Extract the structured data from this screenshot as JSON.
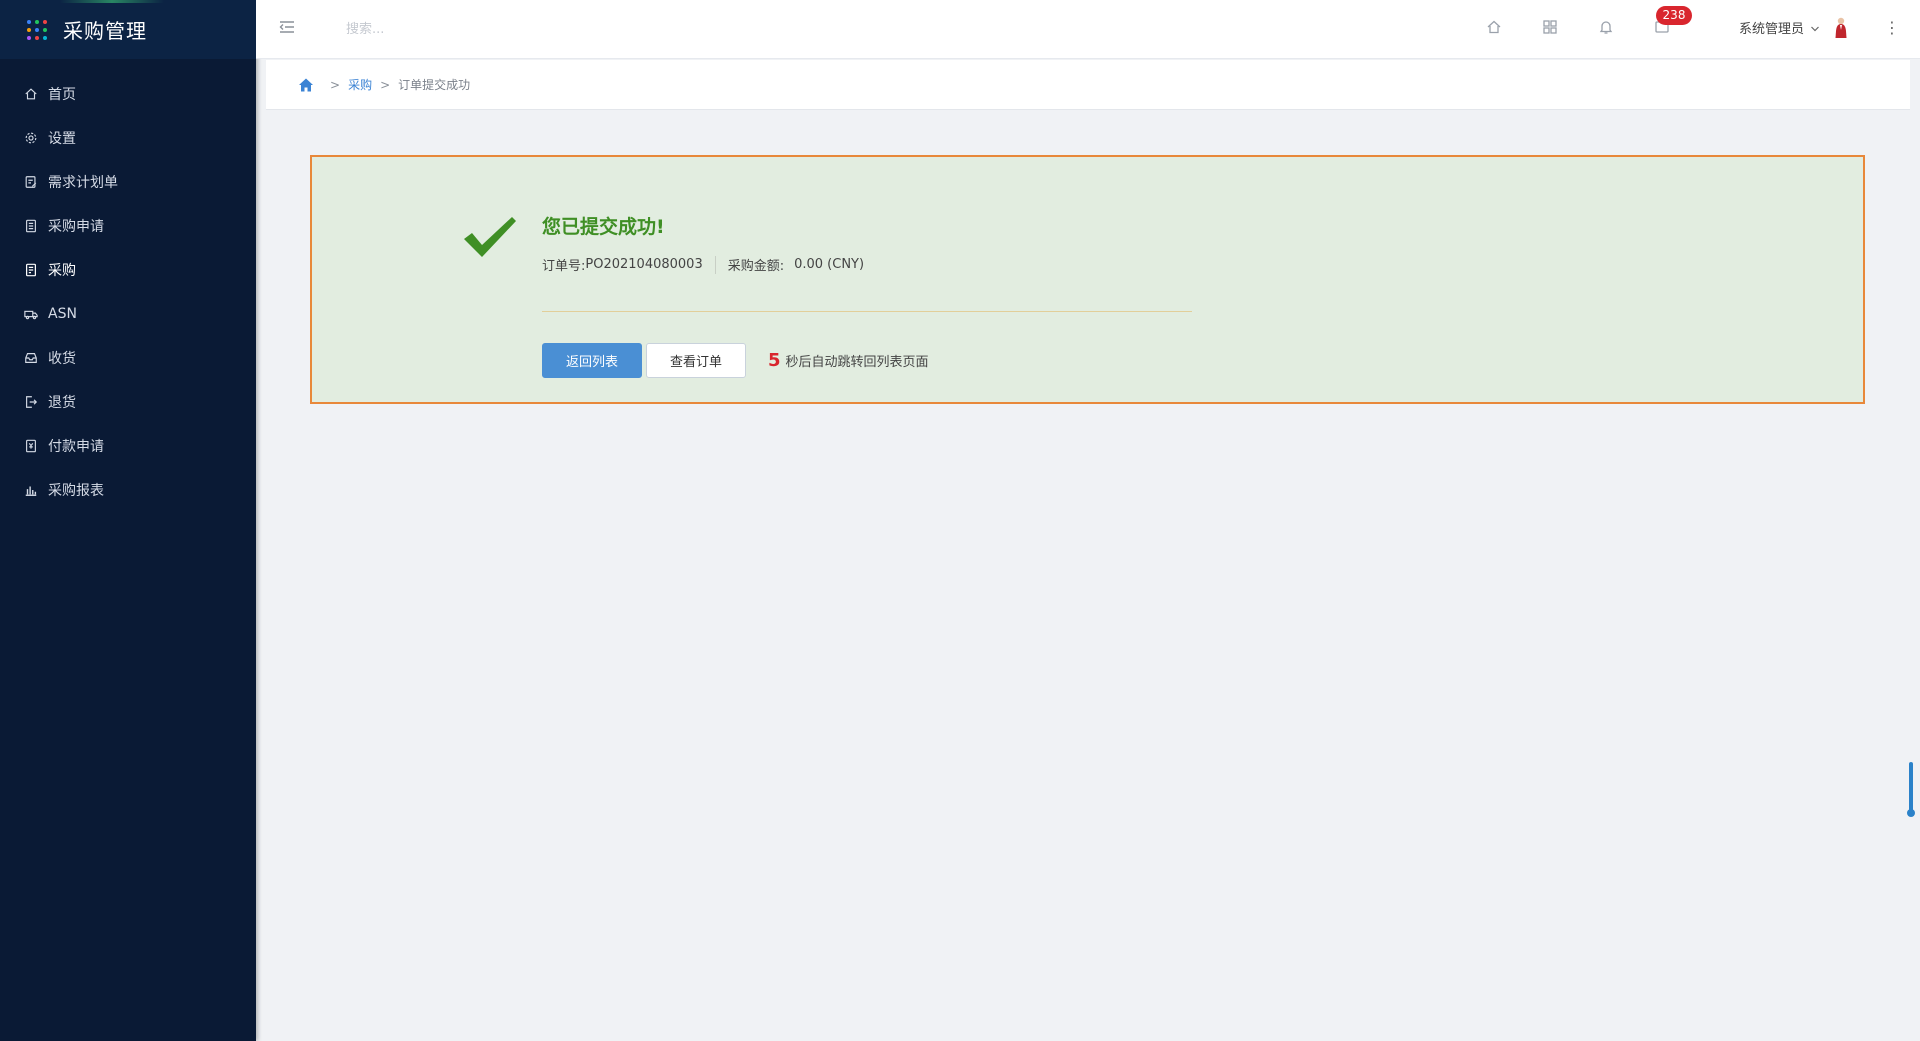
{
  "app": {
    "title": "采购管理",
    "dot_colors": [
      "#3b82f6",
      "#22c55e",
      "#ef4444",
      "#f59e0b",
      "#3b82f6",
      "#22c55e",
      "#a855f7",
      "#ef4444",
      "#06b6d4"
    ]
  },
  "sidebar": {
    "items": [
      {
        "label": "首页",
        "icon": "home-icon"
      },
      {
        "label": "设置",
        "icon": "gear-icon"
      },
      {
        "label": "需求计划单",
        "icon": "edit-document-icon"
      },
      {
        "label": "采购申请",
        "icon": "document-list-icon"
      },
      {
        "label": "采购",
        "icon": "purchase-document-icon",
        "active": true
      },
      {
        "label": "ASN",
        "icon": "truck-icon"
      },
      {
        "label": "收货",
        "icon": "inbox-icon"
      },
      {
        "label": "退货",
        "icon": "exit-icon"
      },
      {
        "label": "付款申请",
        "icon": "payment-document-icon"
      },
      {
        "label": "采购报表",
        "icon": "bar-chart-icon"
      }
    ]
  },
  "header": {
    "search_placeholder": "搜索...",
    "badge_count": "238",
    "user_name": "系统管理员",
    "more": "⋮"
  },
  "breadcrumb": {
    "parent": "采购",
    "current": "订单提交成功",
    "separator": ">"
  },
  "success": {
    "headline": "您已提交成功!",
    "order_label": "订单号:",
    "order_no": "PO202104080003",
    "amount_label": "采购金额:",
    "amount": "0.00 (CNY)",
    "back_button": "返回列表",
    "view_button": "查看订单",
    "countdown_seconds": "5",
    "countdown_text": "秒后自动跳转回列表页面"
  },
  "colors": {
    "sidebar_bg": "#0a1a35",
    "success_green": "#3f8f25",
    "panel_border": "#e8883a",
    "primary_button": "#4a8fd4",
    "badge_red": "#d9262e"
  }
}
